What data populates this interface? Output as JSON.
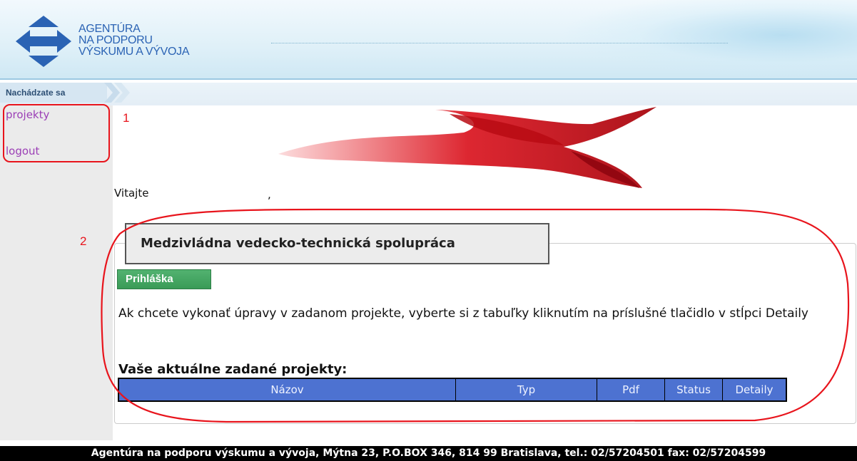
{
  "header": {
    "logo_lines": [
      "AGENTÚRA",
      "NA PODPORU",
      "VÝSKUMU A VÝVOJA"
    ]
  },
  "breadcrumb": {
    "label": "Nachádzate sa"
  },
  "sidebar": {
    "items": [
      {
        "label": "projekty"
      },
      {
        "label": "logout"
      }
    ]
  },
  "annotations": {
    "first": "1",
    "second": "2"
  },
  "main": {
    "welcome": "Vitajte",
    "welcome_suffix": ",",
    "panel_title": "Medzivládna vedecko-technická spolupráca",
    "apply_button": "Prihláška",
    "instruction": "Ak chcete vykonať úpravy v zadanom projekte, vyberte si z tabuľky kliknutím na príslušné tlačidlo v stĺpci Detaily",
    "table_heading": "Vaše aktuálne zadané projekty:",
    "table_columns": [
      "Názov",
      "Typ",
      "Pdf",
      "Status",
      "Detaily"
    ]
  },
  "footer": {
    "text": "Agentúra na podporu výskumu a vývoja, Mýtna 23, P.O.BOX 346, 814 99 Bratislava, tel.: 02/57204501 fax: 02/57204599"
  },
  "colors": {
    "accent_blue": "#2b63b4",
    "link_purple": "#9b3fb6",
    "annotation_red": "#e8141c",
    "button_green": "#3a9b57",
    "table_header_blue": "#4d72d1"
  }
}
